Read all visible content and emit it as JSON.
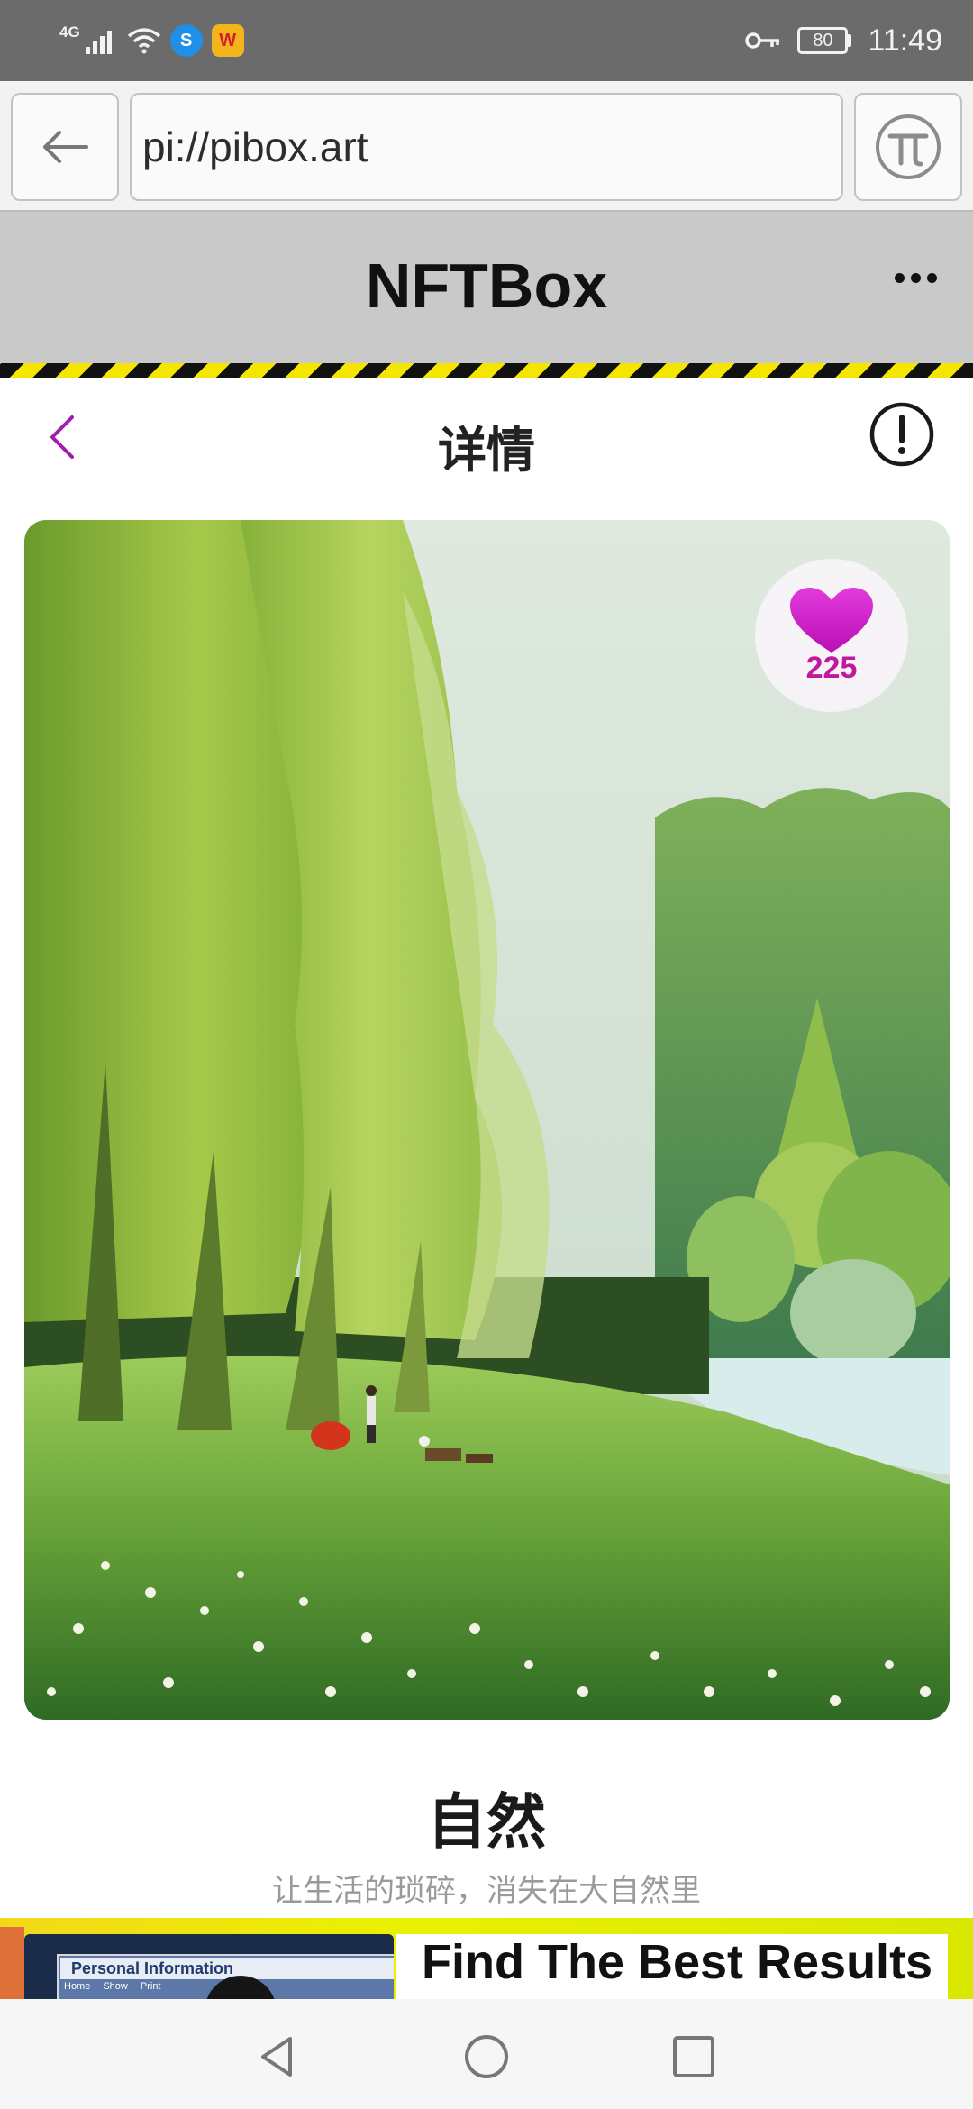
{
  "status_bar": {
    "network": "4G",
    "time": "11:49",
    "battery": "80"
  },
  "browser": {
    "url": "pi://pibox.art"
  },
  "app": {
    "title": "NFTBox"
  },
  "nav": {
    "title": "详情"
  },
  "artwork": {
    "likes": "225",
    "title": "自然",
    "description": "让生活的琐碎，消失在大自然里"
  },
  "ad": {
    "headline": "Find The Best Results",
    "image_heading": "Personal Information",
    "image_tabs": [
      "Home",
      "Show",
      "Print"
    ]
  },
  "colors": {
    "accent": "#a21caf",
    "heart": "#d41bc8",
    "hazard_yellow": "#f5e600"
  }
}
